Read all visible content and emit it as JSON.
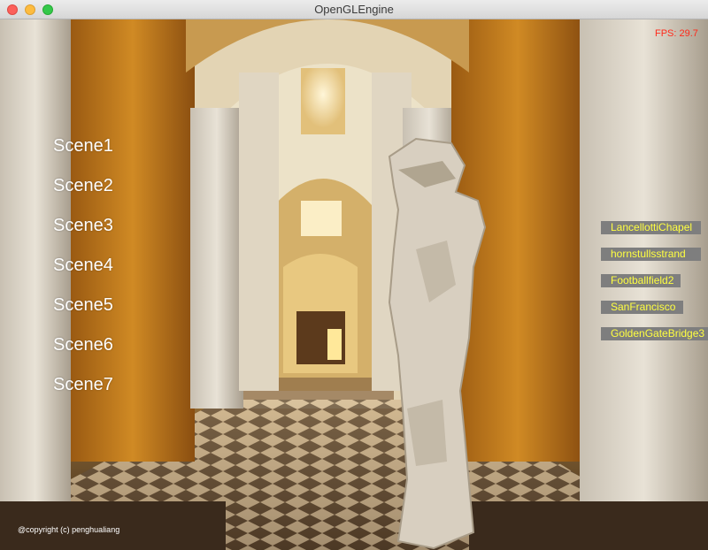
{
  "window": {
    "title": "OpenGLEngine"
  },
  "scenes": [
    "Scene1",
    "Scene2",
    "Scene3",
    "Scene4",
    "Scene5",
    "Scene6",
    "Scene7"
  ],
  "environments": [
    "LancellottiChapel",
    "hornstullsstrand",
    "Footballfield2",
    "SanFrancisco",
    "GoldenGateBridge3"
  ],
  "fps": "FPS: 29.7",
  "copyright": "@copyright (c) penghualiang",
  "colors": {
    "button_bg": "#7e7e7e",
    "button_text": "#ffff40",
    "fps_text": "#ff2a1a"
  }
}
